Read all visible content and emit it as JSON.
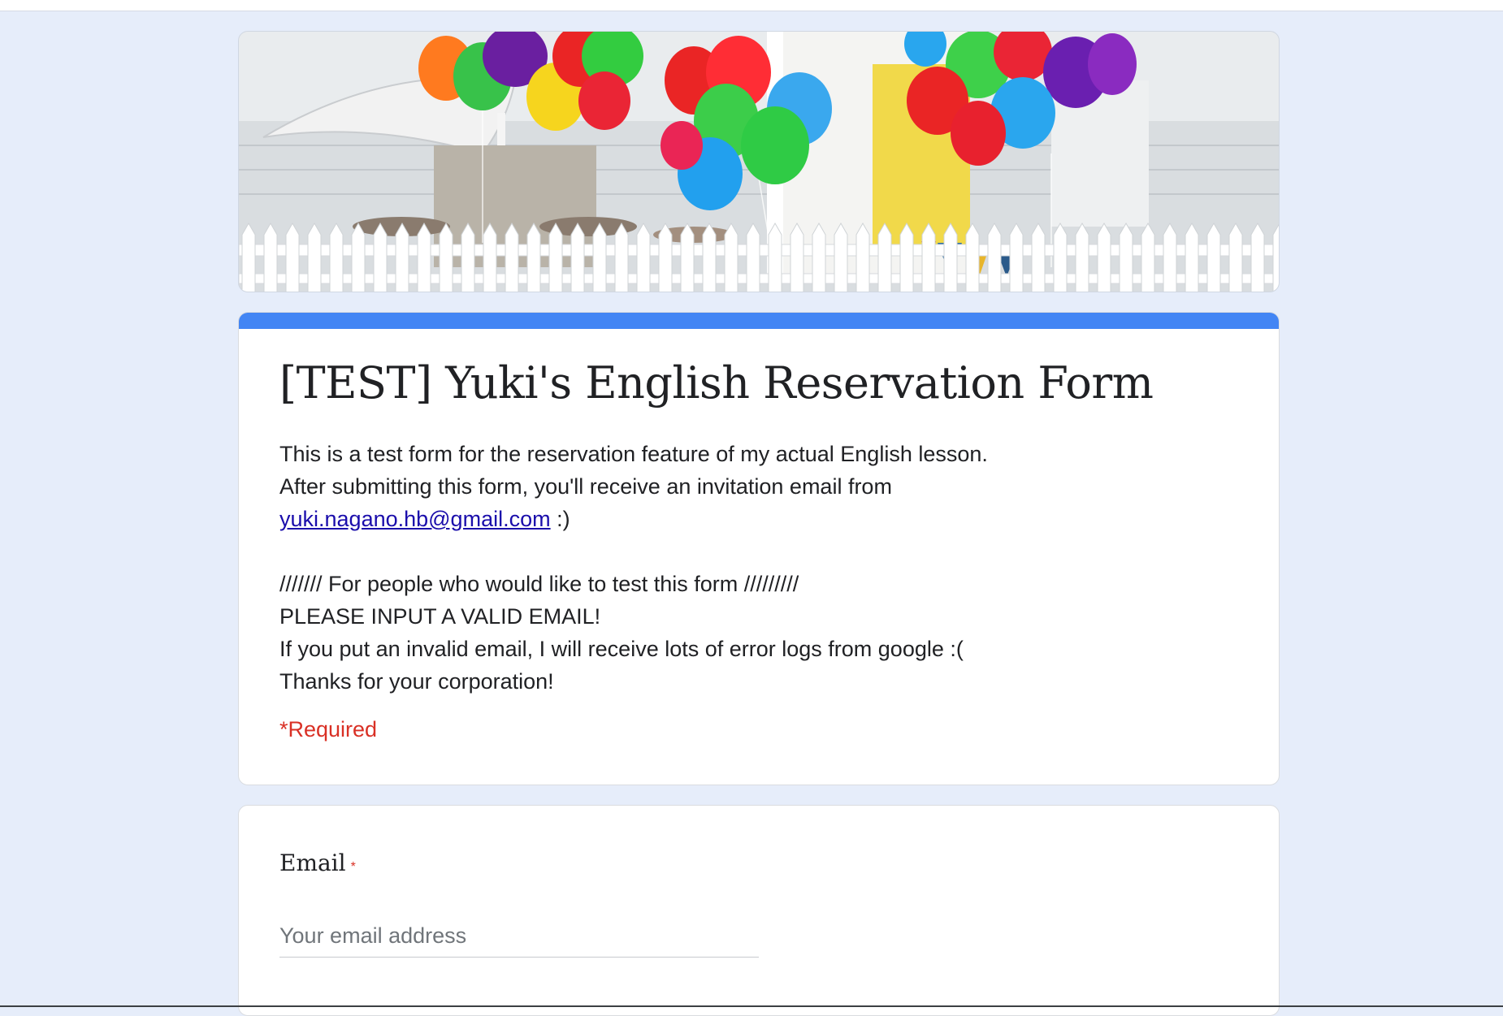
{
  "form": {
    "title": "[TEST] Yuki's English Reservation Form",
    "description_lines": [
      "This is a test form for the reservation feature of my actual English lesson.",
      "After submitting this form, you'll receive an invitation email from",
      "",
      "",
      "/////// For people who would like to test this form /////////",
      "PLEASE INPUT A VALID EMAIL!",
      "If you put an invalid email, I will receive lots of error logs from google :(",
      "Thanks for your corporation!"
    ],
    "email_link": "yuki.nagano.hb@gmail.com",
    "email_link_suffix": " :)",
    "required_note": "*Required"
  },
  "question": {
    "label": "Email",
    "required_mark": "*",
    "placeholder": "Your email address"
  },
  "colors": {
    "accent": "#4285f4",
    "page_background": "#e6edfa",
    "required": "#d93025",
    "link": "#1a0dab"
  }
}
